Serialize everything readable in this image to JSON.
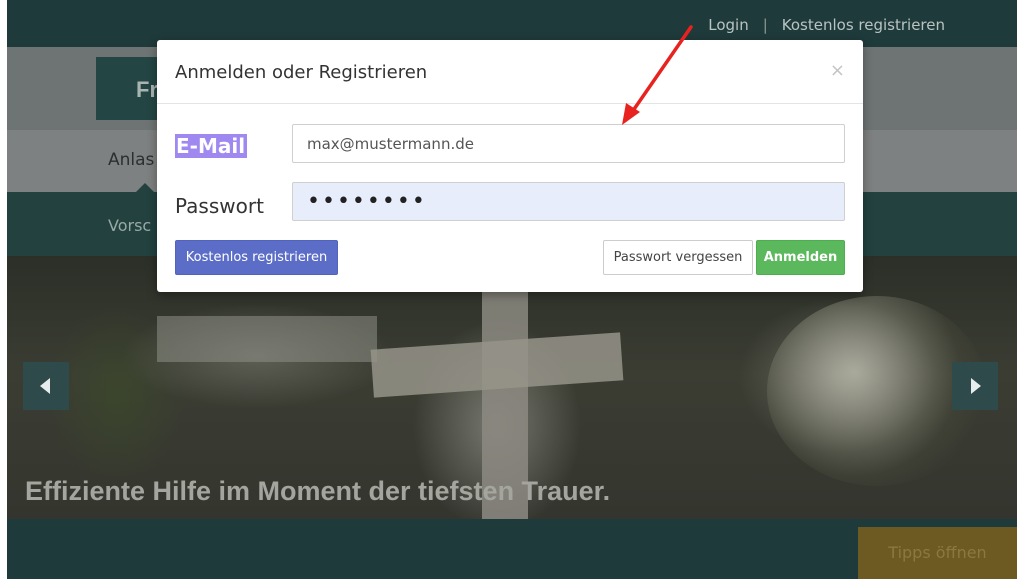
{
  "topbar": {
    "login_link": "Login",
    "separator": "|",
    "register_link": "Kostenlos registrieren"
  },
  "header": {
    "logo_fragment": "Fr"
  },
  "tabs": {
    "active_label": "Anlas"
  },
  "subnav": {
    "item_label": "Vorsc"
  },
  "hero": {
    "caption": "Effiziente Hilfe im Moment der tiefsten Trauer.",
    "prev_icon": "triangle-left-icon",
    "next_icon": "triangle-right-icon"
  },
  "footer": {
    "tipps_button": "Tipps öffnen",
    "tipps_color": "#6c5a22"
  },
  "modal": {
    "title": "Anmelden oder Registrieren",
    "close_glyph": "×",
    "email_label": "E-Mail",
    "email_value": "max@mustermann.de",
    "password_label": "Passwort",
    "password_value": "••••••••",
    "register_button": "Kostenlos registrieren",
    "forgot_button": "Passwort vergessen",
    "login_button": "Anmelden"
  },
  "colors": {
    "topbar": "#1f3a3b",
    "register_button": "#5b6dc7",
    "login_button": "#5cb85c",
    "annotation_arrow": "#e8231f",
    "label_highlight": "#9f88f0"
  },
  "annotation": {
    "icon": "red-arrow-icon"
  }
}
